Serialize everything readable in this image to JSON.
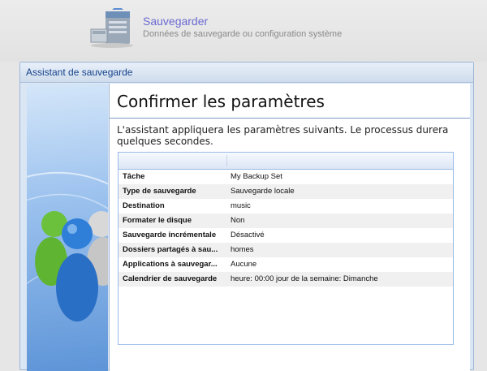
{
  "header": {
    "title": "Sauvegarder",
    "subtitle": "Données de sauvegarde ou configuration système"
  },
  "wizard": {
    "title": "Assistant de sauvegarde",
    "heading": "Confirmer les paramètres",
    "description": "L'assistant appliquera les paramètres suivants. Le processus durera quelques secondes.",
    "rows": [
      {
        "key": "Tâche",
        "value": "My Backup Set"
      },
      {
        "key": "Type de sauvegarde",
        "value": "Sauvegarde locale"
      },
      {
        "key": "Destination",
        "value": "music"
      },
      {
        "key": "Formater le disque",
        "value": "Non"
      },
      {
        "key": "Sauvegarde incrémentale",
        "value": "Désactivé"
      },
      {
        "key": "Dossiers partagés à sau...",
        "value": "homes"
      },
      {
        "key": "Applications à sauvegar...",
        "value": "Aucune"
      },
      {
        "key": "Calendrier de sauvegarde",
        "value": "heure: 00:00 jour de la semaine: Dimanche"
      }
    ]
  },
  "icons": {
    "header_logo": "backup-server-icon",
    "side_art": "users-icon"
  },
  "colors": {
    "title_accent": "#6a6ad2",
    "window_title": "#15428b",
    "grid_border": "#99bbe8"
  }
}
